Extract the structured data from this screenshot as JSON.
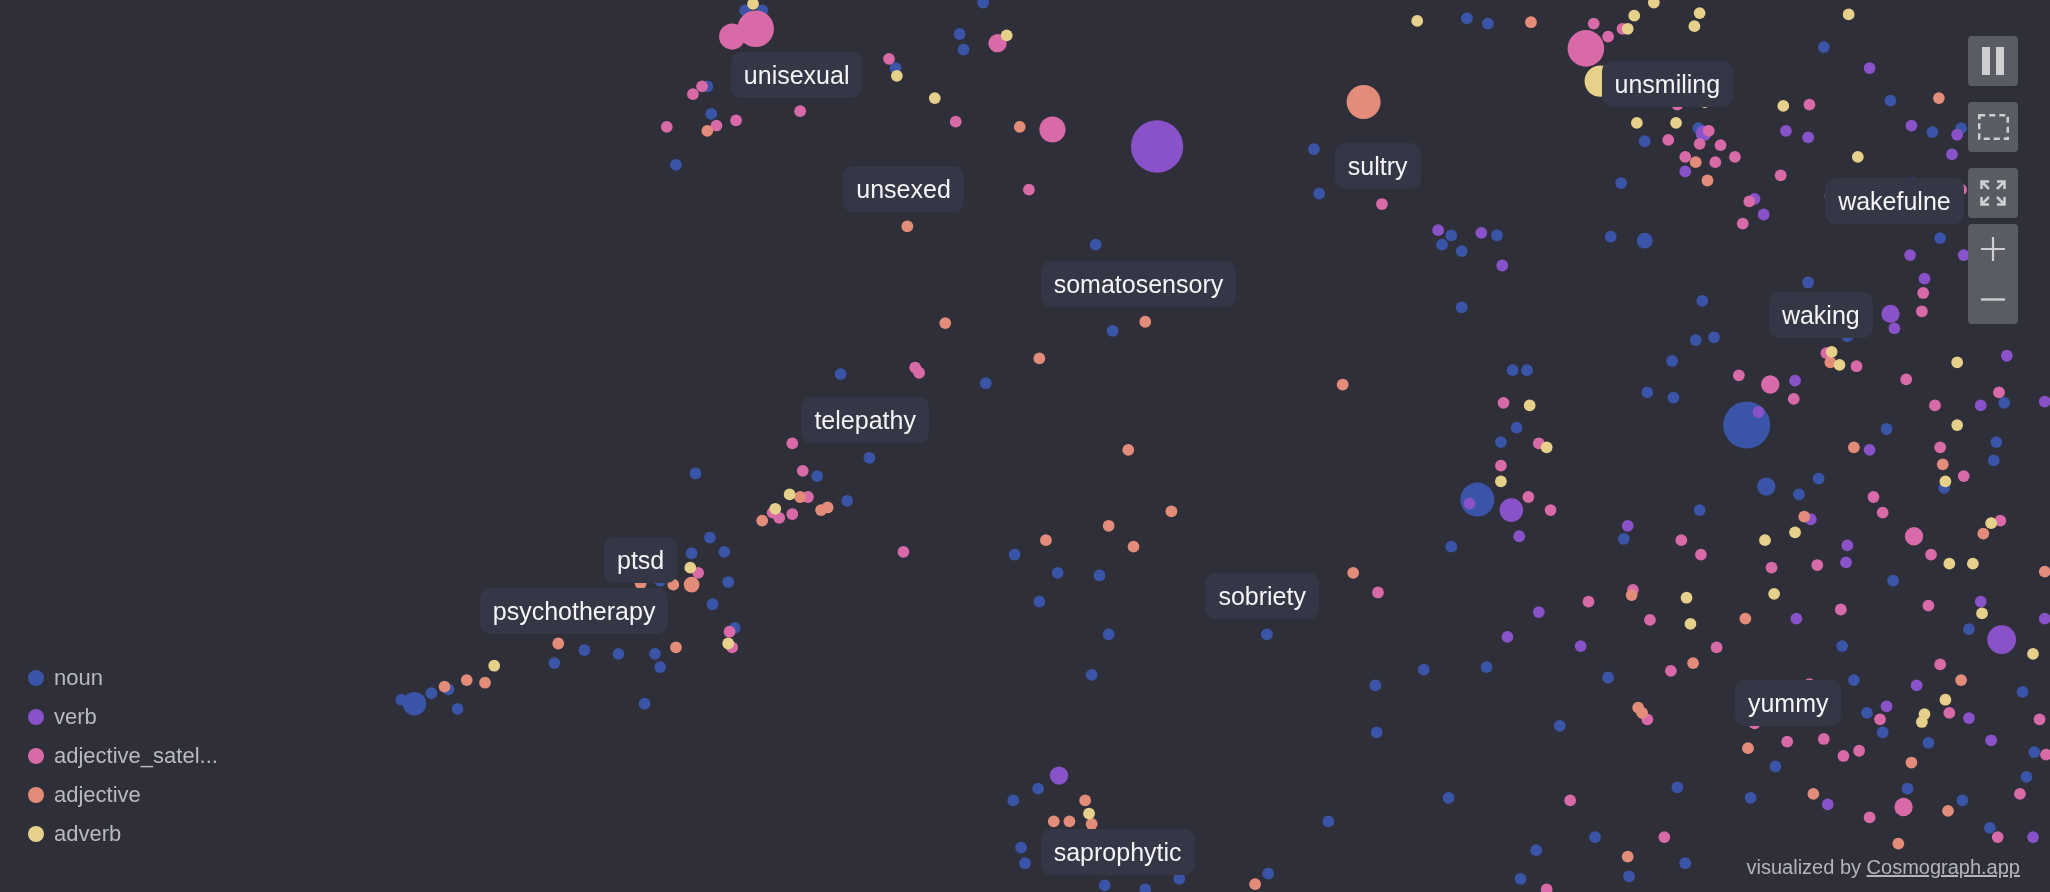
{
  "node_labels": [
    "unisexual",
    "unsmiling",
    "sultry",
    "unsexed",
    "wakefulne",
    "somatosensory",
    "waking",
    "telepathy",
    "ptsd",
    "sobriety",
    "psychotherapy",
    "yummy",
    "saprophytic"
  ],
  "legend": [
    {
      "label": "noun",
      "color": "#3a55a8"
    },
    {
      "label": "verb",
      "color": "#8a52c9"
    },
    {
      "label": "adjective_satel...",
      "color": "#d96aa8"
    },
    {
      "label": "adjective",
      "color": "#e48c7a"
    },
    {
      "label": "adverb",
      "color": "#e6d08a"
    }
  ],
  "credit": {
    "text": "visualized by",
    "link": "Cosmograph.app"
  }
}
